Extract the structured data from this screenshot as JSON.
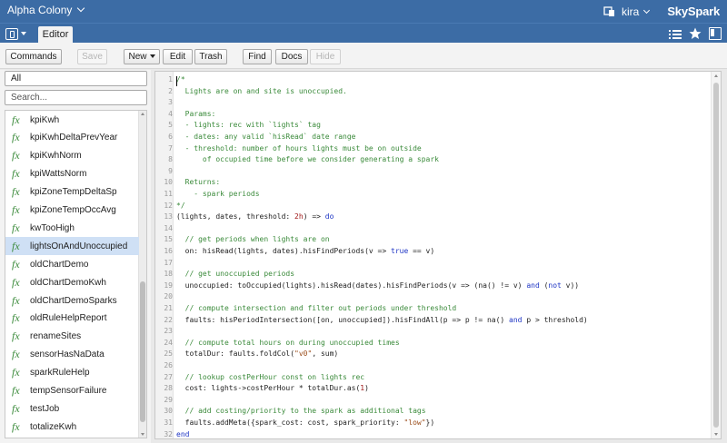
{
  "header": {
    "site_name": "Alpha Colony",
    "username": "kira",
    "brand": "SkySpark",
    "icons": [
      "chevron-down-icon",
      "device-icon",
      "user-chevron-icon"
    ]
  },
  "tabbar": {
    "active_tab": "Editor",
    "icons": [
      "app-switch-icon",
      "list-icon",
      "star-icon",
      "panel-icon"
    ]
  },
  "toolbar": {
    "commands": "Commands",
    "save": "Save",
    "new": "New",
    "edit": "Edit",
    "trash": "Trash",
    "find": "Find",
    "docs": "Docs",
    "hide": "Hide"
  },
  "sidebar": {
    "filter_value": "All",
    "search_placeholder": "Search...",
    "selected_index": 7,
    "items": [
      "kpiKwh",
      "kpiKwhDeltaPrevYear",
      "kpiKwhNorm",
      "kpiWattsNorm",
      "kpiZoneTempDeltaSp",
      "kpiZoneTempOccAvg",
      "kwTooHigh",
      "lightsOnAndUnoccupied",
      "oldChartDemo",
      "oldChartDemoKwh",
      "oldChartDemoSparks",
      "oldRuleHelpReport",
      "renameSites",
      "sensorHasNaData",
      "sparkRuleHelp",
      "tempSensorFailure",
      "testJob",
      "totalizeKwh"
    ]
  },
  "editor": {
    "lines": [
      [
        [
          "/*",
          "com"
        ]
      ],
      [
        [
          "  Lights are on and site is unoccupied.",
          "com"
        ]
      ],
      [
        [
          "",
          "com"
        ]
      ],
      [
        [
          "  Params:",
          "com"
        ]
      ],
      [
        [
          "  - lights: rec with `lights` tag",
          "com"
        ]
      ],
      [
        [
          "  - dates: any valid `hisRead` date range",
          "com"
        ]
      ],
      [
        [
          "  - threshold: number of hours lights must be on outside",
          "com"
        ]
      ],
      [
        [
          "      of occupied time before we consider generating a spark",
          "com"
        ]
      ],
      [
        [
          "",
          "com"
        ]
      ],
      [
        [
          "  Returns:",
          "com"
        ]
      ],
      [
        [
          "    - spark periods",
          "com"
        ]
      ],
      [
        [
          "*/",
          "com"
        ]
      ],
      [
        [
          "(lights, dates, threshold: ",
          "plain"
        ],
        [
          "2h",
          "num"
        ],
        [
          ") => ",
          "plain"
        ],
        [
          "do",
          "kw"
        ]
      ],
      [
        [
          "",
          "plain"
        ]
      ],
      [
        [
          "  // get periods when lights are on",
          "com"
        ]
      ],
      [
        [
          "  on: hisRead(lights, dates).hisFindPeriods(v => ",
          "plain"
        ],
        [
          "true",
          "kw"
        ],
        [
          " == v)",
          "plain"
        ]
      ],
      [
        [
          "",
          "plain"
        ]
      ],
      [
        [
          "  // get unoccupied periods",
          "com"
        ]
      ],
      [
        [
          "  unoccupied: toOccupied(lights).hisRead(dates).hisFindPeriods(v => (na() != v) ",
          "plain"
        ],
        [
          "and",
          "kw"
        ],
        [
          " (",
          "plain"
        ],
        [
          "not",
          "kw"
        ],
        [
          " v))",
          "plain"
        ]
      ],
      [
        [
          "",
          "plain"
        ]
      ],
      [
        [
          "  // compute intersection and filter out periods under threshold",
          "com"
        ]
      ],
      [
        [
          "  faults: hisPeriodIntersection([on, unoccupied]).hisFindAll(p => p != na() ",
          "plain"
        ],
        [
          "and",
          "kw"
        ],
        [
          " p > threshold)",
          "plain"
        ]
      ],
      [
        [
          "",
          "plain"
        ]
      ],
      [
        [
          "  // compute total hours on during unoccupied times",
          "com"
        ]
      ],
      [
        [
          "  totalDur: faults.foldCol(",
          "plain"
        ],
        [
          "\"v0\"",
          "str"
        ],
        [
          ", sum)",
          "plain"
        ]
      ],
      [
        [
          "",
          "plain"
        ]
      ],
      [
        [
          "  // lookup costPerHour const on lights rec",
          "com"
        ]
      ],
      [
        [
          "  cost: lights->costPerHour * totalDur.as(",
          "plain"
        ],
        [
          "1",
          "num"
        ],
        [
          ")",
          "plain"
        ]
      ],
      [
        [
          "",
          "plain"
        ]
      ],
      [
        [
          "  // add costing/priority to the spark as additional tags",
          "com"
        ]
      ],
      [
        [
          "  faults.addMeta({spark_cost: cost, spark_priority: ",
          "plain"
        ],
        [
          "\"low\"",
          "str"
        ],
        [
          "})",
          "plain"
        ]
      ],
      [
        [
          "end",
          "kw"
        ]
      ]
    ]
  },
  "colors": {
    "header_bg": "#3c6ca5",
    "comment": "#3a8a3a",
    "keyword": "#1d34c4",
    "string": "#9b4d1b",
    "number": "#a01a1a",
    "selected_row": "#cfe0f5"
  }
}
